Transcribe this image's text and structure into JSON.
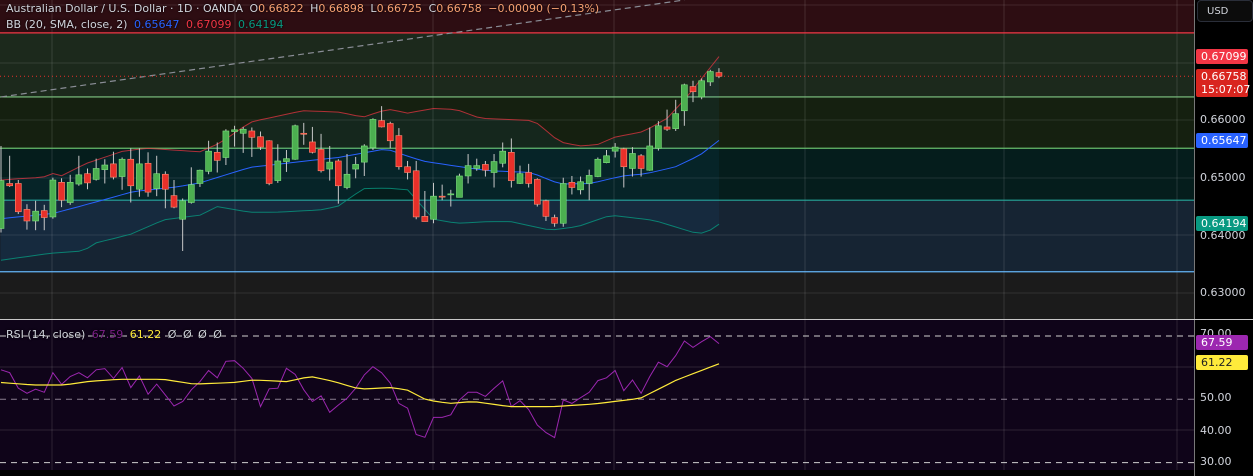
{
  "header": {
    "title": "Australian Dollar / U.S. Dollar · 1D · OANDA",
    "o_label": "O",
    "o": "0.66822",
    "h_label": "H",
    "h": "0.66898",
    "l_label": "L",
    "l": "0.66725",
    "c_label": "C",
    "c": "0.66758",
    "change": "−0.00090 (−0.13%)"
  },
  "bb_legend": {
    "label": "BB (20, SMA, close, 2)",
    "basis": "0.65647",
    "upper": "0.67099",
    "lower": "0.64194"
  },
  "rsi_legend": {
    "label": "RSI (14, close)",
    "rsi": "67.59",
    "ma": "61.22",
    "extra": [
      "Ø",
      "Ø",
      "Ø",
      "Ø"
    ]
  },
  "axis": {
    "currency": "USD",
    "price_ticks": [
      "0.66000",
      "0.65000",
      "0.64000",
      "0.63000"
    ],
    "rsi_ticks": [
      "70.00",
      "50.00",
      "40.00",
      "30.00"
    ],
    "tags": {
      "upper": "0.67099",
      "last": "0.66758",
      "countdown": "15:07:07",
      "basis": "0.65647",
      "lower": "0.64194",
      "rsi": "67.59",
      "rsi_ma": "61.22"
    }
  },
  "colors": {
    "up": "#4caf50",
    "down": "#e8302a",
    "bb_upper": "#f23645",
    "bb_basis": "#2962ff",
    "bb_lower": "#089981",
    "rsi": "#9c27b0",
    "rsi_ma": "#ffeb3b"
  },
  "chart_data": {
    "type": "candlestick",
    "price_range": [
      0.625,
      0.6805
    ],
    "rsi_range": [
      28,
      74
    ],
    "candles_ohlc": [
      [
        0.6412,
        0.6555,
        0.6405,
        0.6495
      ],
      [
        0.649,
        0.6538,
        0.6484,
        0.6486
      ],
      [
        0.649,
        0.6496,
        0.6437,
        0.6441
      ],
      [
        0.6445,
        0.6454,
        0.641,
        0.6425
      ],
      [
        0.6425,
        0.646,
        0.6409,
        0.6442
      ],
      [
        0.6443,
        0.6453,
        0.6409,
        0.6431
      ],
      [
        0.6432,
        0.65,
        0.6429,
        0.6496
      ],
      [
        0.6492,
        0.6499,
        0.6449,
        0.6461
      ],
      [
        0.6457,
        0.6505,
        0.6453,
        0.6492
      ],
      [
        0.6489,
        0.6538,
        0.6486,
        0.6505
      ],
      [
        0.6507,
        0.6516,
        0.648,
        0.6491
      ],
      [
        0.6497,
        0.6533,
        0.6495,
        0.6516
      ],
      [
        0.6514,
        0.6532,
        0.649,
        0.6522
      ],
      [
        0.6524,
        0.6545,
        0.6497,
        0.6501
      ],
      [
        0.6502,
        0.6535,
        0.6479,
        0.6532
      ],
      [
        0.6532,
        0.6551,
        0.6457,
        0.6486
      ],
      [
        0.648,
        0.6551,
        0.6467,
        0.6524
      ],
      [
        0.6525,
        0.6544,
        0.6467,
        0.6475
      ],
      [
        0.6481,
        0.6538,
        0.6468,
        0.6507
      ],
      [
        0.6506,
        0.6511,
        0.6447,
        0.648
      ],
      [
        0.6469,
        0.6496,
        0.6447,
        0.6449
      ],
      [
        0.6428,
        0.6464,
        0.6373,
        0.646
      ],
      [
        0.6457,
        0.6518,
        0.6455,
        0.6488
      ],
      [
        0.649,
        0.6514,
        0.6484,
        0.6513
      ],
      [
        0.6511,
        0.6564,
        0.6506,
        0.6546
      ],
      [
        0.6544,
        0.6561,
        0.6509,
        0.653
      ],
      [
        0.6535,
        0.6584,
        0.6522,
        0.6581
      ],
      [
        0.658,
        0.659,
        0.6554,
        0.6583
      ],
      [
        0.6577,
        0.6588,
        0.6543,
        0.6584
      ],
      [
        0.6581,
        0.6587,
        0.6536,
        0.657
      ],
      [
        0.6571,
        0.658,
        0.6548,
        0.6553
      ],
      [
        0.6564,
        0.6565,
        0.6487,
        0.649
      ],
      [
        0.6495,
        0.6558,
        0.6491,
        0.6529
      ],
      [
        0.6528,
        0.6548,
        0.651,
        0.6533
      ],
      [
        0.6532,
        0.6592,
        0.6531,
        0.659
      ],
      [
        0.6577,
        0.6595,
        0.6557,
        0.6576
      ],
      [
        0.6562,
        0.6588,
        0.6542,
        0.6544
      ],
      [
        0.6549,
        0.6576,
        0.6509,
        0.6512
      ],
      [
        0.6515,
        0.6555,
        0.6495,
        0.6527
      ],
      [
        0.6529,
        0.6532,
        0.6455,
        0.6486
      ],
      [
        0.6483,
        0.6541,
        0.648,
        0.6506
      ],
      [
        0.6515,
        0.6536,
        0.6499,
        0.6523
      ],
      [
        0.6527,
        0.6558,
        0.6503,
        0.6555
      ],
      [
        0.6552,
        0.6603,
        0.6548,
        0.6601
      ],
      [
        0.6599,
        0.6624,
        0.6587,
        0.6588
      ],
      [
        0.6594,
        0.6597,
        0.6551,
        0.6564
      ],
      [
        0.6573,
        0.6586,
        0.6514,
        0.6519
      ],
      [
        0.6519,
        0.6529,
        0.6497,
        0.6509
      ],
      [
        0.6512,
        0.6529,
        0.6428,
        0.6432
      ],
      [
        0.6433,
        0.6477,
        0.6424,
        0.6424
      ],
      [
        0.6428,
        0.6491,
        0.6421,
        0.6468
      ],
      [
        0.6468,
        0.6488,
        0.6461,
        0.6467
      ],
      [
        0.6471,
        0.6479,
        0.645,
        0.6472
      ],
      [
        0.6466,
        0.6507,
        0.6466,
        0.6503
      ],
      [
        0.6503,
        0.6541,
        0.649,
        0.6521
      ],
      [
        0.6516,
        0.6533,
        0.6512,
        0.6521
      ],
      [
        0.6523,
        0.6529,
        0.6502,
        0.6513
      ],
      [
        0.6509,
        0.6541,
        0.6483,
        0.6528
      ],
      [
        0.6525,
        0.6561,
        0.6518,
        0.6546
      ],
      [
        0.6544,
        0.6568,
        0.6483,
        0.6495
      ],
      [
        0.649,
        0.6521,
        0.6489,
        0.6507
      ],
      [
        0.6509,
        0.6524,
        0.6483,
        0.649
      ],
      [
        0.6497,
        0.6499,
        0.645,
        0.6454
      ],
      [
        0.646,
        0.6462,
        0.6425,
        0.6433
      ],
      [
        0.6431,
        0.6436,
        0.6415,
        0.6421
      ],
      [
        0.6421,
        0.65,
        0.6415,
        0.649
      ],
      [
        0.6492,
        0.6503,
        0.6471,
        0.6483
      ],
      [
        0.6479,
        0.6502,
        0.6471,
        0.6493
      ],
      [
        0.649,
        0.6514,
        0.6461,
        0.6504
      ],
      [
        0.6502,
        0.6535,
        0.6501,
        0.6532
      ],
      [
        0.6526,
        0.6548,
        0.6525,
        0.6538
      ],
      [
        0.6546,
        0.656,
        0.6535,
        0.6553
      ],
      [
        0.655,
        0.6552,
        0.6483,
        0.6519
      ],
      [
        0.6516,
        0.6553,
        0.6502,
        0.6542
      ],
      [
        0.6538,
        0.6541,
        0.6502,
        0.6516
      ],
      [
        0.6513,
        0.6587,
        0.6512,
        0.6555
      ],
      [
        0.6551,
        0.6598,
        0.6547,
        0.659
      ],
      [
        0.6588,
        0.6618,
        0.6581,
        0.6584
      ],
      [
        0.6585,
        0.6635,
        0.6581,
        0.6611
      ],
      [
        0.6616,
        0.6663,
        0.659,
        0.6661
      ],
      [
        0.6658,
        0.6668,
        0.6631,
        0.6649
      ],
      [
        0.664,
        0.6672,
        0.6636,
        0.6668
      ],
      [
        0.6666,
        0.6687,
        0.6659,
        0.6684
      ],
      [
        0.66822,
        0.66898,
        0.66725,
        0.66758
      ]
    ],
    "bb_upper_points": [
      [
        0,
        0.6496
      ],
      [
        4.9,
        0.6501
      ],
      [
        5.9,
        0.6508
      ],
      [
        6.8,
        0.6502
      ],
      [
        9.9,
        0.6525
      ],
      [
        14.1,
        0.6546
      ],
      [
        16.8,
        0.6551
      ],
      [
        23,
        0.6545
      ],
      [
        25.3,
        0.656
      ],
      [
        28.8,
        0.6596
      ],
      [
        29.9,
        0.66
      ],
      [
        34.9,
        0.6616
      ],
      [
        38.9,
        0.6614
      ],
      [
        41.9,
        0.6605
      ],
      [
        44.7,
        0.6619
      ],
      [
        47,
        0.6612
      ],
      [
        50,
        0.662
      ],
      [
        52.7,
        0.6618
      ],
      [
        55.4,
        0.6603
      ],
      [
        61.6,
        0.6599
      ],
      [
        64.6,
        0.6562
      ],
      [
        66.9,
        0.6555
      ],
      [
        68.9,
        0.6557
      ],
      [
        70.9,
        0.657
      ],
      [
        74.3,
        0.658
      ],
      [
        77,
        0.6603
      ],
      [
        79.3,
        0.664
      ],
      [
        83,
        0.67099
      ]
    ],
    "bb_basis_points": [
      [
        0,
        0.6429
      ],
      [
        6,
        0.6438
      ],
      [
        11,
        0.6458
      ],
      [
        15.3,
        0.6476
      ],
      [
        20.3,
        0.6484
      ],
      [
        23,
        0.6491
      ],
      [
        28.8,
        0.6518
      ],
      [
        35.3,
        0.6529
      ],
      [
        39,
        0.6535
      ],
      [
        44.5,
        0.655
      ],
      [
        48.7,
        0.6529
      ],
      [
        52.6,
        0.652
      ],
      [
        56.4,
        0.6512
      ],
      [
        61.3,
        0.6509
      ],
      [
        64.6,
        0.6489
      ],
      [
        68.1,
        0.649
      ],
      [
        71.9,
        0.6503
      ],
      [
        74.6,
        0.6507
      ],
      [
        78,
        0.6519
      ],
      [
        80.8,
        0.6539
      ],
      [
        83,
        0.65647
      ]
    ],
    "bb_lower_points": [
      [
        0,
        0.6357
      ],
      [
        5.7,
        0.6369
      ],
      [
        9.5,
        0.6373
      ],
      [
        11,
        0.6387
      ],
      [
        15,
        0.6402
      ],
      [
        18.8,
        0.6427
      ],
      [
        23,
        0.6435
      ],
      [
        25,
        0.645
      ],
      [
        28.8,
        0.644
      ],
      [
        31.5,
        0.644
      ],
      [
        36.8,
        0.6444
      ],
      [
        38.9,
        0.645
      ],
      [
        41.9,
        0.6481
      ],
      [
        44.6,
        0.6482
      ],
      [
        47,
        0.6479
      ],
      [
        50,
        0.6428
      ],
      [
        52.7,
        0.6421
      ],
      [
        56.5,
        0.6424
      ],
      [
        58.9,
        0.6424
      ],
      [
        63.5,
        0.6409
      ],
      [
        66.6,
        0.6415
      ],
      [
        70.5,
        0.6435
      ],
      [
        75.5,
        0.6426
      ],
      [
        80.5,
        0.6403
      ],
      [
        81.6,
        0.6405
      ],
      [
        83,
        0.64194
      ]
    ],
    "rsi": [
      59.3,
      58.4,
      53.5,
      51.9,
      53.2,
      52.2,
      58.4,
      54.7,
      57.2,
      58.4,
      56.8,
      59.3,
      59.7,
      56.6,
      60.0,
      53.7,
      57.4,
      51.6,
      54.8,
      51.4,
      47.9,
      49.3,
      53.0,
      55.6,
      59.1,
      56.8,
      62.0,
      62.2,
      59.8,
      56.6,
      47.7,
      53.3,
      53.5,
      59.8,
      57.9,
      53.0,
      49.3,
      51.1,
      45.9,
      48.2,
      50.3,
      53.5,
      57.7,
      60.3,
      58.4,
      55.1,
      48.7,
      47.2,
      38.9,
      38.0,
      44.3,
      44.3,
      45.1,
      49.8,
      52.2,
      52.2,
      50.9,
      53.5,
      55.8,
      47.7,
      49.6,
      46.8,
      41.9,
      39.5,
      37.9,
      49.8,
      48.7,
      50.5,
      52.2,
      55.9,
      56.8,
      59.1,
      52.7,
      56.1,
      51.9,
      57.2,
      61.7,
      60.3,
      63.8,
      68.4,
      66.4,
      68.2,
      69.8,
      67.59
    ],
    "rsi_ma_points": [
      [
        0,
        55.3
      ],
      [
        3.8,
        54.5
      ],
      [
        7.3,
        54.5
      ],
      [
        10,
        55.6
      ],
      [
        13.5,
        56.3
      ],
      [
        18.8,
        56.3
      ],
      [
        22.3,
        54.8
      ],
      [
        26.9,
        55.3
      ],
      [
        29.2,
        56.1
      ],
      [
        33,
        55.6
      ],
      [
        35.8,
        57.2
      ],
      [
        38.5,
        55.6
      ],
      [
        41.5,
        53.2
      ],
      [
        45,
        53.7
      ],
      [
        46.9,
        53.0
      ],
      [
        49.2,
        49.8
      ],
      [
        51.9,
        48.7
      ],
      [
        54.6,
        49.3
      ],
      [
        58.8,
        47.7
      ],
      [
        63.9,
        47.7
      ],
      [
        68.5,
        48.5
      ],
      [
        73.9,
        50.3
      ],
      [
        78.1,
        56.1
      ],
      [
        83,
        61.22
      ]
    ],
    "levels": [
      {
        "price": 0.6751,
        "color": "#f23645"
      },
      {
        "price": 0.664,
        "color": "#81c784"
      },
      {
        "price": 0.6551,
        "color": "#66bb6a"
      },
      {
        "price": 0.6461,
        "color": "#26a69a"
      },
      {
        "price": 0.6337,
        "color": "#64b5f6"
      }
    ],
    "trendline": {
      "from": [
        0,
        0.664
      ],
      "to": [
        79,
        0.6808
      ]
    },
    "rsi_bands": {
      "upper": 70,
      "middle": 50,
      "lower": 30
    }
  }
}
